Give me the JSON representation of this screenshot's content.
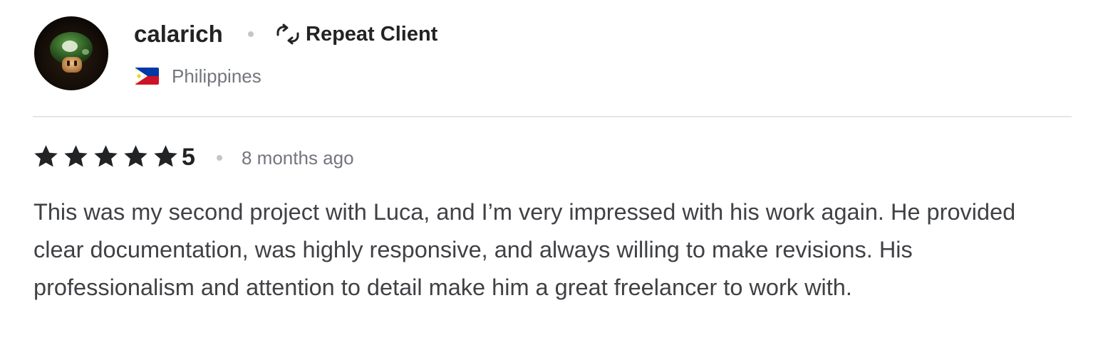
{
  "reviewer": {
    "username": "calarich",
    "badge_label": "Repeat Client",
    "badge_icon": "repeat-icon",
    "country": "Philippines",
    "flag_icon": "philippines-flag-icon",
    "avatar_icon": "green-mushroom-avatar"
  },
  "rating": {
    "stars": 5,
    "max_stars": 5,
    "value_label": "5",
    "time_ago": "8 months ago"
  },
  "review": {
    "text": "This was my second project with Luca, and I’m very impressed with his work again. He provided clear documentation, was highly responsive, and always willing to make revisions. His professionalism and attention to detail make him a great freelancer to work with."
  },
  "colors": {
    "primary_text": "#222325",
    "secondary_text": "#74767e",
    "body_text": "#404145",
    "divider": "#e4e5e7",
    "dot": "#c5c6c9"
  }
}
